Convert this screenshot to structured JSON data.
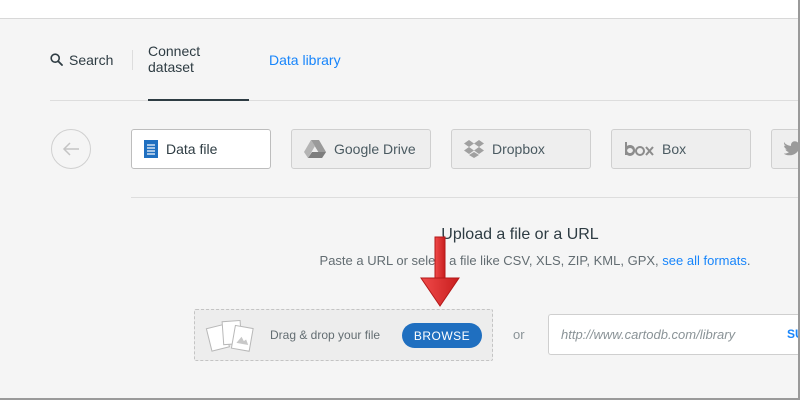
{
  "nav": {
    "search_label": "Search",
    "connect_label": "Connect dataset",
    "library_label": "Data library"
  },
  "sources": {
    "data_file": "Data file",
    "google_drive": "Google Drive",
    "dropbox": "Dropbox",
    "box": "Box"
  },
  "upload": {
    "title": "Upload a file or a URL",
    "description": "Paste a URL or select a file like CSV, XLS, ZIP, KML, GPX,",
    "formats_link": "see all formats",
    "description_end": ".",
    "drop_label": "Drag & drop your file",
    "browse_label": "BROWSE",
    "or_label": "or",
    "url_placeholder": "http://www.cartodb.com/library",
    "submit_label": "SU"
  },
  "colors": {
    "accent": "#1785fb",
    "browse_button": "#1f6fc0",
    "annotation_arrow": "#e8282b",
    "text": "#2e3c43"
  },
  "icons": {
    "search": "search-icon",
    "back": "arrow-left-icon",
    "data_file": "document-icon",
    "google_drive": "google-drive-icon",
    "dropbox": "dropbox-icon",
    "box": "box-logo-icon",
    "twitter": "twitter-icon",
    "files": "files-icon",
    "annotation": "red-arrow-down-icon"
  }
}
